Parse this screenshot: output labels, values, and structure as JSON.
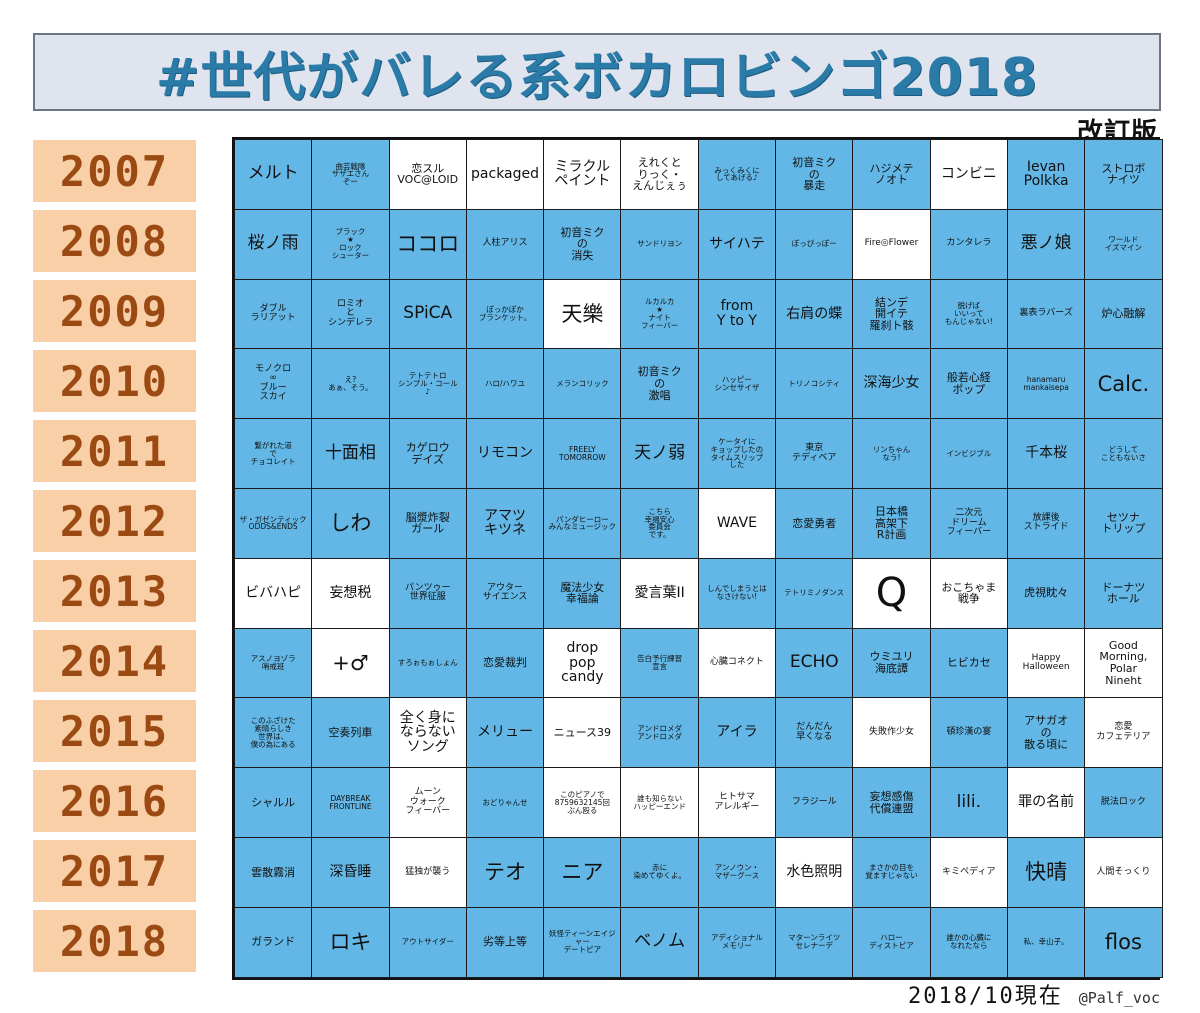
{
  "header": {
    "title": "#世代がバレる系ボカロビンゴ2018",
    "subtitle": "改訂版",
    "title_color": "#2a7ba8",
    "title_bg": "#dfe4ee"
  },
  "footer": {
    "date": "2018/10現在",
    "handle": "@Palf_voc"
  },
  "colors": {
    "cell_marked": "#62b7e6",
    "cell_unmarked": "#ffffff",
    "year_bg": "#f8cfa6",
    "year_text": "#9c4a14"
  },
  "years": [
    "2007",
    "2008",
    "2009",
    "2010",
    "2011",
    "2012",
    "2013",
    "2014",
    "2015",
    "2016",
    "2017",
    "2018"
  ],
  "grid": [
    {
      "year": "2007",
      "cells": [
        {
          "text": "メルト",
          "marked": true,
          "size": "l"
        },
        {
          "text": "曲芸戦隊\nサザエさん\nぞー",
          "marked": true,
          "size": "xxs"
        },
        {
          "text": "恋スル\nVOC@LOID",
          "marked": false,
          "size": "s"
        },
        {
          "text": "packaged",
          "marked": false,
          "size": "m"
        },
        {
          "text": "ミラクル\nペイント",
          "marked": false,
          "size": "m"
        },
        {
          "text": "えれくと\nりっく・\nえんじぇぅ",
          "marked": false,
          "size": "s"
        },
        {
          "text": "みっくみくに\nしてあげる♪",
          "marked": true,
          "size": "xxs"
        },
        {
          "text": "初音ミク\nの\n暴走",
          "marked": true,
          "size": "s"
        },
        {
          "text": "ハジメテ\nノオト",
          "marked": true,
          "size": "s"
        },
        {
          "text": "コンビニ",
          "marked": false,
          "size": "m"
        },
        {
          "text": "Ievan\nPolkka",
          "marked": true,
          "size": "m"
        },
        {
          "text": "ストロボ\nナイツ",
          "marked": true,
          "size": "s"
        }
      ]
    },
    {
      "year": "2008",
      "cells": [
        {
          "text": "桜ノ雨",
          "marked": true,
          "size": "l"
        },
        {
          "text": "ブラック\n★\nロック\nシューター",
          "marked": true,
          "size": "xxs"
        },
        {
          "text": "ココロ",
          "marked": true,
          "size": "xl"
        },
        {
          "text": "人柱アリス",
          "marked": true,
          "size": "xs"
        },
        {
          "text": "初音ミク\nの\n消失",
          "marked": true,
          "size": "s"
        },
        {
          "text": "サンドリヨン",
          "marked": true,
          "size": "xxs"
        },
        {
          "text": "サイハテ",
          "marked": true,
          "size": "m"
        },
        {
          "text": "ぽっぴっぽー",
          "marked": true,
          "size": "xxs"
        },
        {
          "text": "Fire◎Flower",
          "marked": false,
          "size": "xs"
        },
        {
          "text": "カンタレラ",
          "marked": true,
          "size": "xs"
        },
        {
          "text": "悪ノ娘",
          "marked": true,
          "size": "l"
        },
        {
          "text": "ワールド\nイズマイン",
          "marked": true,
          "size": "xxs"
        }
      ]
    },
    {
      "year": "2009",
      "cells": [
        {
          "text": "ダブル\nラリアット",
          "marked": true,
          "size": "xs"
        },
        {
          "text": "ロミオ\nと\nシンデレラ",
          "marked": true,
          "size": "xs"
        },
        {
          "text": "SPiCA",
          "marked": true,
          "size": "l"
        },
        {
          "text": "ぽっかぽか\nブランケット。",
          "marked": true,
          "size": "xxs"
        },
        {
          "text": "天樂",
          "marked": false,
          "size": "xl"
        },
        {
          "text": "ルカルカ\n★\nナイト\nフィーバー",
          "marked": true,
          "size": "xxs"
        },
        {
          "text": "from\nY to Y",
          "marked": true,
          "size": "m"
        },
        {
          "text": "右肩の蝶",
          "marked": true,
          "size": "m"
        },
        {
          "text": "結ンデ\n開イテ\n羅刹ト骸",
          "marked": true,
          "size": "s"
        },
        {
          "text": "脱げば\nいいって\nもんじゃない!",
          "marked": true,
          "size": "xxs"
        },
        {
          "text": "裏表ラバーズ",
          "marked": true,
          "size": "xs"
        },
        {
          "text": "炉心融解",
          "marked": true,
          "size": "s"
        }
      ]
    },
    {
      "year": "2010",
      "cells": [
        {
          "text": "モノクロ\n∞\nブルー\nスカイ",
          "marked": true,
          "size": "xs"
        },
        {
          "text": "え?\nあぁ、そう。",
          "marked": true,
          "size": "xxs"
        },
        {
          "text": "テトテトロ\nシンプル・コール\n♪",
          "marked": true,
          "size": "xxs"
        },
        {
          "text": "ハロ/ハワユ",
          "marked": true,
          "size": "xxs"
        },
        {
          "text": "メランコリック",
          "marked": true,
          "size": "xxs"
        },
        {
          "text": "初音ミク\nの\n激唱",
          "marked": true,
          "size": "s"
        },
        {
          "text": "ハッピー\nシンセサイザ",
          "marked": true,
          "size": "xxs"
        },
        {
          "text": "トリノコシティ",
          "marked": true,
          "size": "xxs"
        },
        {
          "text": "深海少女",
          "marked": true,
          "size": "m"
        },
        {
          "text": "般若心経\nポップ",
          "marked": true,
          "size": "s"
        },
        {
          "text": "hanamaru\nmankaisepa",
          "marked": true,
          "size": "xxs"
        },
        {
          "text": "Calc.",
          "marked": true,
          "size": "xl"
        }
      ]
    },
    {
      "year": "2011",
      "cells": [
        {
          "text": "繋がれた道\nで\nチョコレイト",
          "marked": true,
          "size": "xxs"
        },
        {
          "text": "十面相",
          "marked": true,
          "size": "l"
        },
        {
          "text": "カゲロウ\nデイズ",
          "marked": true,
          "size": "s"
        },
        {
          "text": "リモコン",
          "marked": true,
          "size": "m"
        },
        {
          "text": "FREELY\nTOMORROW",
          "marked": true,
          "size": "xxs"
        },
        {
          "text": "天ノ弱",
          "marked": true,
          "size": "l"
        },
        {
          "text": "ケータイに\nキョップしたの\nタイムスリップ\nした",
          "marked": true,
          "size": "xxs"
        },
        {
          "text": "東京\nテディベア",
          "marked": true,
          "size": "xs"
        },
        {
          "text": "リンちゃん\nなう!",
          "marked": true,
          "size": "xxs"
        },
        {
          "text": "インビジブル",
          "marked": true,
          "size": "xxs"
        },
        {
          "text": "千本桜",
          "marked": true,
          "size": "m"
        },
        {
          "text": "どうして\nこともないさ",
          "marked": true,
          "size": "xxs"
        }
      ]
    },
    {
      "year": "2012",
      "cells": [
        {
          "text": "ザ・ガゼンティック\nODDS&ENDS",
          "marked": true,
          "size": "xxs"
        },
        {
          "text": "しわ",
          "marked": true,
          "size": "xl"
        },
        {
          "text": "脳漿炸裂\nガール",
          "marked": true,
          "size": "s"
        },
        {
          "text": "アマツ\nキツネ",
          "marked": true,
          "size": "m"
        },
        {
          "text": "パンダヒーロー\nみんなミュージック",
          "marked": true,
          "size": "xxs"
        },
        {
          "text": "こちら\n幸福安心\n委員会\nです。",
          "marked": true,
          "size": "xxs"
        },
        {
          "text": "WAVE",
          "marked": false,
          "size": "m"
        },
        {
          "text": "恋愛勇者",
          "marked": true,
          "size": "s"
        },
        {
          "text": "日本橋\n高架下\nR計画",
          "marked": true,
          "size": "s"
        },
        {
          "text": "二次元\nドリーム\nフィーバー",
          "marked": true,
          "size": "xs"
        },
        {
          "text": "放課後\nストライド",
          "marked": true,
          "size": "xs"
        },
        {
          "text": "セツナ\nトリップ",
          "marked": true,
          "size": "s"
        }
      ]
    },
    {
      "year": "2013",
      "cells": [
        {
          "text": "ビバハピ",
          "marked": false,
          "size": "m"
        },
        {
          "text": "妄想税",
          "marked": false,
          "size": "m"
        },
        {
          "text": "パンツゥー\n世界征服",
          "marked": true,
          "size": "xs"
        },
        {
          "text": "アウター\nサイエンス",
          "marked": true,
          "size": "xs"
        },
        {
          "text": "魔法少女\n幸福論",
          "marked": true,
          "size": "s"
        },
        {
          "text": "愛言葉II",
          "marked": false,
          "size": "m"
        },
        {
          "text": "しんでしまうとは\nなさけない!",
          "marked": true,
          "size": "xxs"
        },
        {
          "text": "テトリミノダンス",
          "marked": true,
          "size": "xxs"
        },
        {
          "text": "Q",
          "marked": false,
          "size": "q"
        },
        {
          "text": "おこちゃま\n戦争",
          "marked": false,
          "size": "s"
        },
        {
          "text": "虎視眈々",
          "marked": true,
          "size": "s"
        },
        {
          "text": "ドーナツ\nホール",
          "marked": true,
          "size": "s"
        }
      ]
    },
    {
      "year": "2014",
      "cells": [
        {
          "text": "アスノヨゾラ\n哨戒班",
          "marked": true,
          "size": "xxs"
        },
        {
          "text": "+♂",
          "marked": false,
          "size": "xl"
        },
        {
          "text": "すろぉもぉしょん",
          "marked": true,
          "size": "xxs"
        },
        {
          "text": "恋愛裁判",
          "marked": true,
          "size": "s"
        },
        {
          "text": "drop\npop\ncandy",
          "marked": false,
          "size": "m"
        },
        {
          "text": "告白予行練習\n宣言",
          "marked": true,
          "size": "xxs"
        },
        {
          "text": "心臓コネクト",
          "marked": false,
          "size": "xs"
        },
        {
          "text": "ECHO",
          "marked": true,
          "size": "l"
        },
        {
          "text": "ウミユリ\n海底譚",
          "marked": true,
          "size": "s"
        },
        {
          "text": "ヒビカセ",
          "marked": true,
          "size": "s"
        },
        {
          "text": "Happy\nHalloween",
          "marked": false,
          "size": "xs"
        },
        {
          "text": "Good\nMorning,\nPolar\nNineht",
          "marked": false,
          "size": "s"
        }
      ]
    },
    {
      "year": "2015",
      "cells": [
        {
          "text": "このふざけた\n素晴らしき\n世界は、\n僕の為にある",
          "marked": true,
          "size": "xxs"
        },
        {
          "text": "空奏列車",
          "marked": true,
          "size": "s"
        },
        {
          "text": "全く身に\nならない\nソング",
          "marked": false,
          "size": "m"
        },
        {
          "text": "メリュー",
          "marked": true,
          "size": "m"
        },
        {
          "text": "ニュース39",
          "marked": false,
          "size": "s"
        },
        {
          "text": "アンドロメダ\nアンドロメダ",
          "marked": true,
          "size": "xxs"
        },
        {
          "text": "アイラ",
          "marked": true,
          "size": "m"
        },
        {
          "text": "だんだん\n早くなる",
          "marked": true,
          "size": "xs"
        },
        {
          "text": "失敗作少女",
          "marked": false,
          "size": "xs"
        },
        {
          "text": "頓珍漢の宴",
          "marked": true,
          "size": "xs"
        },
        {
          "text": "アサガオ\nの\n散る頃に",
          "marked": true,
          "size": "s"
        },
        {
          "text": "恋愛\nカフェテリア",
          "marked": false,
          "size": "xs"
        }
      ]
    },
    {
      "year": "2016",
      "cells": [
        {
          "text": "シャルル",
          "marked": true,
          "size": "s"
        },
        {
          "text": "DAYBREAK\nFRONTLINE",
          "marked": true,
          "size": "xxs"
        },
        {
          "text": "ムーン\nウォーク\nフィーバー",
          "marked": false,
          "size": "xs"
        },
        {
          "text": "おどりゃんせ",
          "marked": true,
          "size": "xxs"
        },
        {
          "text": "このピアノで\n8759632145回\nぶん殴る",
          "marked": false,
          "size": "xxs"
        },
        {
          "text": "誰も知らない\nハッピーエンド",
          "marked": false,
          "size": "xxs"
        },
        {
          "text": "ヒトサマ\nアレルギー",
          "marked": false,
          "size": "xs"
        },
        {
          "text": "フラジール",
          "marked": true,
          "size": "xs"
        },
        {
          "text": "妄想感傷\n代償連盟",
          "marked": true,
          "size": "s"
        },
        {
          "text": "lili.",
          "marked": true,
          "size": "l"
        },
        {
          "text": "罪の名前",
          "marked": false,
          "size": "m"
        },
        {
          "text": "脱法ロック",
          "marked": true,
          "size": "xs"
        }
      ]
    },
    {
      "year": "2017",
      "cells": [
        {
          "text": "雲散霧消",
          "marked": true,
          "size": "s"
        },
        {
          "text": "深昏睡",
          "marked": true,
          "size": "m"
        },
        {
          "text": "猛独が襲う",
          "marked": false,
          "size": "xs"
        },
        {
          "text": "テオ",
          "marked": true,
          "size": "xl"
        },
        {
          "text": "ニア",
          "marked": true,
          "size": "xl"
        },
        {
          "text": "赤に\n染めてゆくよ。",
          "marked": true,
          "size": "xxs"
        },
        {
          "text": "アンノウン・\nマザーグース",
          "marked": true,
          "size": "xxs"
        },
        {
          "text": "水色照明",
          "marked": false,
          "size": "m"
        },
        {
          "text": "まさかの目を\n覚ますじゃない",
          "marked": true,
          "size": "xxs"
        },
        {
          "text": "キミペディア",
          "marked": false,
          "size": "xs"
        },
        {
          "text": "快晴",
          "marked": true,
          "size": "xl"
        },
        {
          "text": "人間そっくり",
          "marked": false,
          "size": "xs"
        }
      ]
    },
    {
      "year": "2018",
      "cells": [
        {
          "text": "ガランド",
          "marked": true,
          "size": "s"
        },
        {
          "text": "ロキ",
          "marked": true,
          "size": "xl"
        },
        {
          "text": "アウトサイダー",
          "marked": true,
          "size": "xxs"
        },
        {
          "text": "劣等上等",
          "marked": true,
          "size": "s"
        },
        {
          "text": "妖怪ティーンエイジャー\nデートピア",
          "marked": true,
          "size": "xxs"
        },
        {
          "text": "ベノム",
          "marked": true,
          "size": "l"
        },
        {
          "text": "アディショナル\nメモリー",
          "marked": true,
          "size": "xxs"
        },
        {
          "text": "マターンライツ\nセレナーデ",
          "marked": true,
          "size": "xxs"
        },
        {
          "text": "ハロー\nディストピア",
          "marked": true,
          "size": "xxs"
        },
        {
          "text": "誰かの心臓に\nなれたなら",
          "marked": true,
          "size": "xxs"
        },
        {
          "text": "私、幸山子。",
          "marked": true,
          "size": "xxs"
        },
        {
          "text": "flos",
          "marked": true,
          "size": "xl"
        }
      ]
    }
  ]
}
